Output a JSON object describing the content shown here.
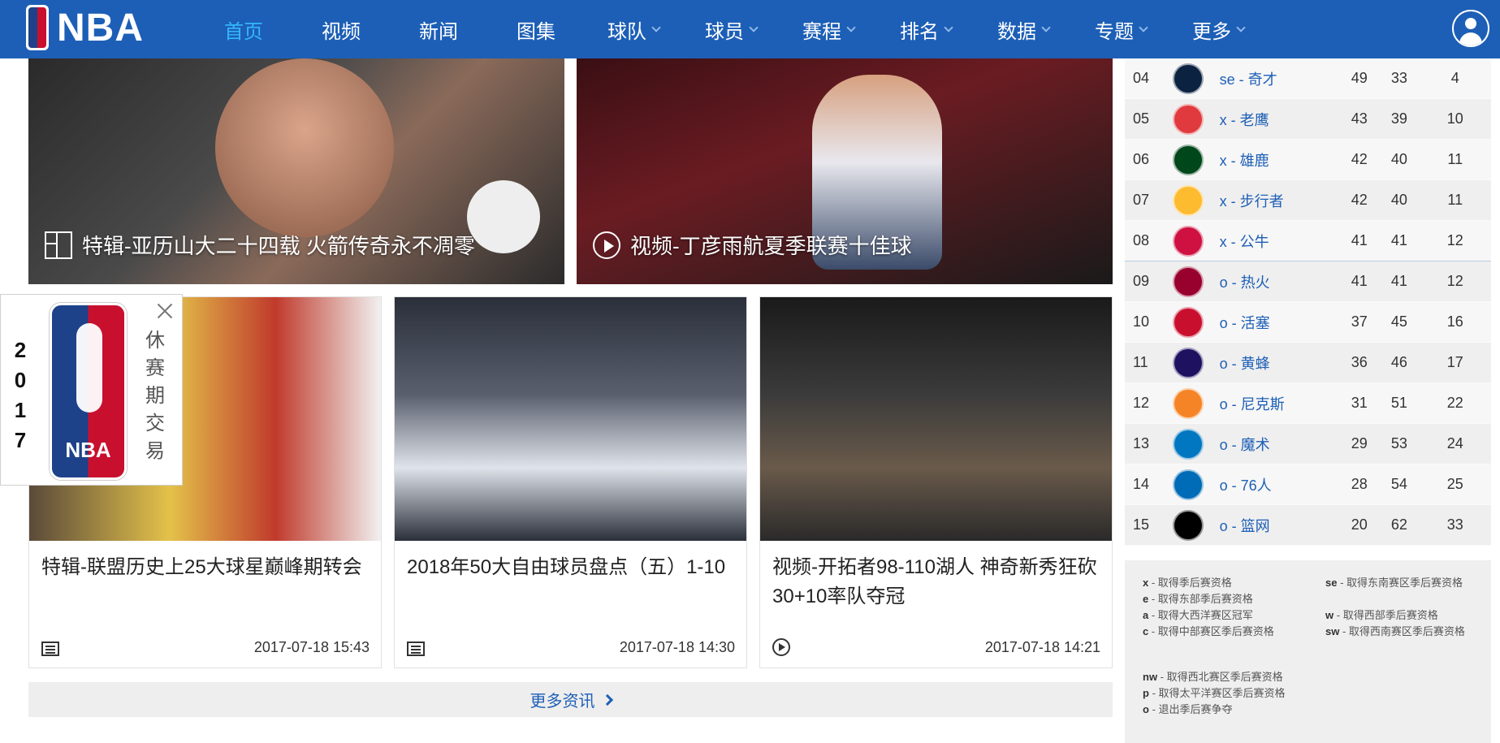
{
  "brand": {
    "name": "NBA"
  },
  "nav": {
    "items": [
      {
        "label": "首页",
        "active": true,
        "dropdown": false
      },
      {
        "label": "视频",
        "dropdown": false
      },
      {
        "label": "新闻",
        "dropdown": false
      },
      {
        "label": "图集",
        "dropdown": false
      },
      {
        "label": "球队",
        "dropdown": true
      },
      {
        "label": "球员",
        "dropdown": true
      },
      {
        "label": "赛程",
        "dropdown": true
      },
      {
        "label": "排名",
        "dropdown": true
      },
      {
        "label": "数据",
        "dropdown": true
      },
      {
        "label": "专题",
        "dropdown": true
      },
      {
        "label": "更多",
        "dropdown": true
      }
    ]
  },
  "features": [
    {
      "caption": "特辑-亚历山大二十四载 火箭传奇永不凋零",
      "icon": "gallery-icon"
    },
    {
      "caption": "视频-丁彦雨航夏季联赛十佳球",
      "icon": "play-icon"
    }
  ],
  "cards": [
    {
      "title": "特辑-联盟历史上25大球星巅峰期转会",
      "date": "2017-07-18 15:43",
      "icon": "news-icon"
    },
    {
      "title": "2018年50大自由球员盘点（五）1-10",
      "date": "2017-07-18 14:30",
      "icon": "news-icon"
    },
    {
      "title": "视频-开拓者98-110湖人 神奇新秀狂砍30+10率队夺冠",
      "date": "2017-07-18 14:21",
      "icon": "play-icon"
    }
  ],
  "more_news": "更多资讯",
  "promo": {
    "year_digits": [
      "2",
      "0",
      "1",
      "7"
    ],
    "text": [
      "休",
      "赛",
      "期",
      "交",
      "易"
    ],
    "logo_text": "NBA"
  },
  "standings": [
    {
      "rank": "04",
      "team": "se - 奇才",
      "w": "49",
      "l": "33",
      "gb": "4",
      "color": "#0b2240"
    },
    {
      "rank": "05",
      "team": "x - 老鹰",
      "w": "43",
      "l": "39",
      "gb": "10",
      "color": "#e03a3e"
    },
    {
      "rank": "06",
      "team": "x - 雄鹿",
      "w": "42",
      "l": "40",
      "gb": "11",
      "color": "#00471b"
    },
    {
      "rank": "07",
      "team": "x - 步行者",
      "w": "42",
      "l": "40",
      "gb": "11",
      "color": "#fdbb30"
    },
    {
      "rank": "08",
      "team": "x - 公牛",
      "w": "41",
      "l": "41",
      "gb": "12",
      "color": "#ce1141"
    },
    {
      "rank": "09",
      "team": "o - 热火",
      "w": "41",
      "l": "41",
      "gb": "12",
      "color": "#98002e"
    },
    {
      "rank": "10",
      "team": "o - 活塞",
      "w": "37",
      "l": "45",
      "gb": "16",
      "color": "#c8102e"
    },
    {
      "rank": "11",
      "team": "o - 黄蜂",
      "w": "36",
      "l": "46",
      "gb": "17",
      "color": "#1d1160"
    },
    {
      "rank": "12",
      "team": "o - 尼克斯",
      "w": "31",
      "l": "51",
      "gb": "22",
      "color": "#f58426"
    },
    {
      "rank": "13",
      "team": "o - 魔术",
      "w": "29",
      "l": "53",
      "gb": "24",
      "color": "#0077c0"
    },
    {
      "rank": "14",
      "team": "o - 76人",
      "w": "28",
      "l": "54",
      "gb": "25",
      "color": "#006bb6"
    },
    {
      "rank": "15",
      "team": "o - 篮网",
      "w": "20",
      "l": "62",
      "gb": "33",
      "color": "#000000"
    }
  ],
  "legend": [
    {
      "key": "x",
      "desc": "取得季后赛资格"
    },
    {
      "key": "se",
      "desc": "取得东南赛区季后赛资格"
    },
    {
      "key": "e",
      "desc": "取得东部季后赛资格"
    },
    {
      "key": "w",
      "desc": "取得西部季后赛资格"
    },
    {
      "key": "a",
      "desc": "取得大西洋赛区冠军"
    },
    {
      "key": "sw",
      "desc": "取得西南赛区季后赛资格"
    },
    {
      "key": "c",
      "desc": "取得中部赛区季后赛资格"
    },
    {
      "key": "nw",
      "desc": "取得西北赛区季后赛资格"
    },
    {
      "key": "p",
      "desc": "取得太平洋赛区季后赛资格"
    },
    {
      "key": "o",
      "desc": "退出季后赛争夺"
    }
  ]
}
